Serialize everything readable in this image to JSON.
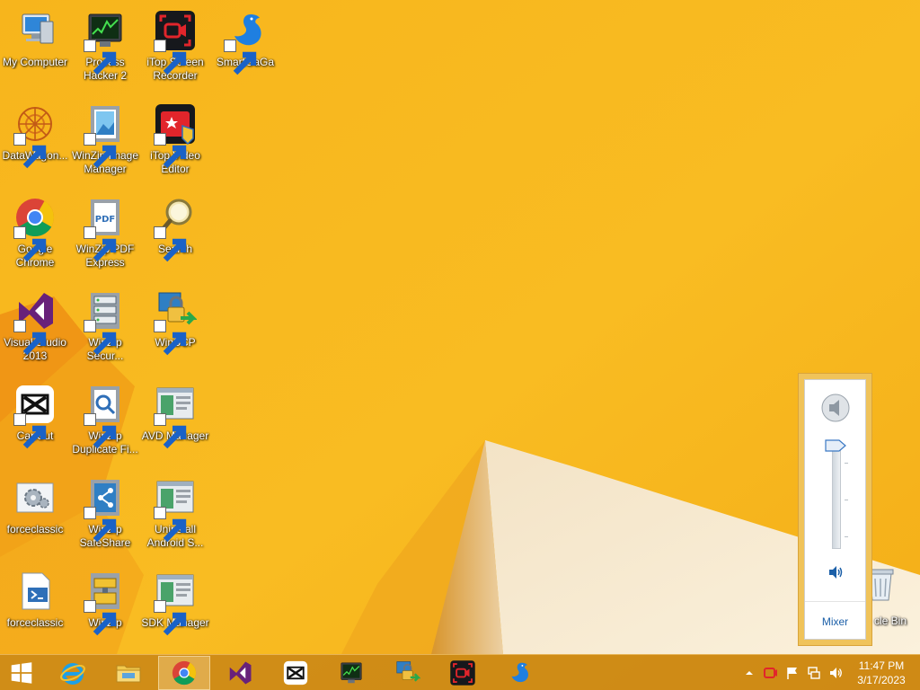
{
  "desktop": {
    "icons": [
      {
        "label": "My Computer",
        "icon": "computer-icon"
      },
      {
        "label": "Process Hacker 2",
        "icon": "process-hacker-icon"
      },
      {
        "label": "iTop Screen Recorder",
        "icon": "screen-recorder-icon"
      },
      {
        "label": "SmartGaGa",
        "icon": "smartgaga-icon"
      },
      {
        "label": "DataWagon...",
        "icon": "datawagon-icon"
      },
      {
        "label": "WinZip Image Manager",
        "icon": "winzip-image-icon"
      },
      {
        "label": "iTop Video Editor",
        "icon": "video-editor-icon"
      },
      {
        "label": "Google Chrome",
        "icon": "chrome-icon"
      },
      {
        "label": "WinZip PDF Express",
        "icon": "winzip-pdf-icon"
      },
      {
        "label": "Search",
        "icon": "search-icon"
      },
      {
        "label": "Visual Studio 2013",
        "icon": "visual-studio-icon"
      },
      {
        "label": "WinZip Secur...",
        "icon": "winzip-secure-icon"
      },
      {
        "label": "WinSCP",
        "icon": "winscp-icon"
      },
      {
        "label": "CapCut",
        "icon": "capcut-icon"
      },
      {
        "label": "WinZip Duplicate Fi...",
        "icon": "winzip-duplicate-icon"
      },
      {
        "label": "AVD Manager",
        "icon": "avd-manager-icon"
      },
      {
        "label": "forceclassic",
        "icon": "settings-gear-icon"
      },
      {
        "label": "WinZip SafeShare",
        "icon": "winzip-safeshare-icon"
      },
      {
        "label": "Uninstall Android S...",
        "icon": "uninstall-android-icon"
      },
      {
        "label": "forceclassic",
        "icon": "powershell-script-icon"
      },
      {
        "label": "WinZip",
        "icon": "winzip-icon"
      },
      {
        "label": "SDK Manager",
        "icon": "sdk-manager-icon"
      }
    ],
    "recycle_bin_label": "cle Bin"
  },
  "volume": {
    "mixer_label": "Mixer"
  },
  "taskbar": {
    "items": [
      {
        "name": "start-button",
        "icon": "windows-logo-icon"
      },
      {
        "name": "internet-explorer",
        "icon": "ie-icon"
      },
      {
        "name": "file-explorer",
        "icon": "folder-icon"
      },
      {
        "name": "google-chrome",
        "icon": "chrome-icon",
        "active": true
      },
      {
        "name": "visual-studio",
        "icon": "visual-studio-icon"
      },
      {
        "name": "capcut",
        "icon": "capcut-icon"
      },
      {
        "name": "process-hacker",
        "icon": "process-hacker-icon"
      },
      {
        "name": "winscp",
        "icon": "winscp-icon"
      },
      {
        "name": "itop-screen-recorder",
        "icon": "screen-recorder-icon"
      },
      {
        "name": "smartgaga",
        "icon": "smartgaga-icon"
      }
    ],
    "tray": {
      "icons": [
        "chevron-up-icon",
        "recorder-tray-icon",
        "flag-icon",
        "network-icon",
        "speaker-icon"
      ]
    },
    "clock": {
      "time": "11:47 PM",
      "date": "3/17/2023"
    }
  },
  "colors": {
    "wallpaper_orange": "#f6b21a",
    "wallpaper_dark": "#ee8a12",
    "accent_link": "#1b5fa8"
  }
}
